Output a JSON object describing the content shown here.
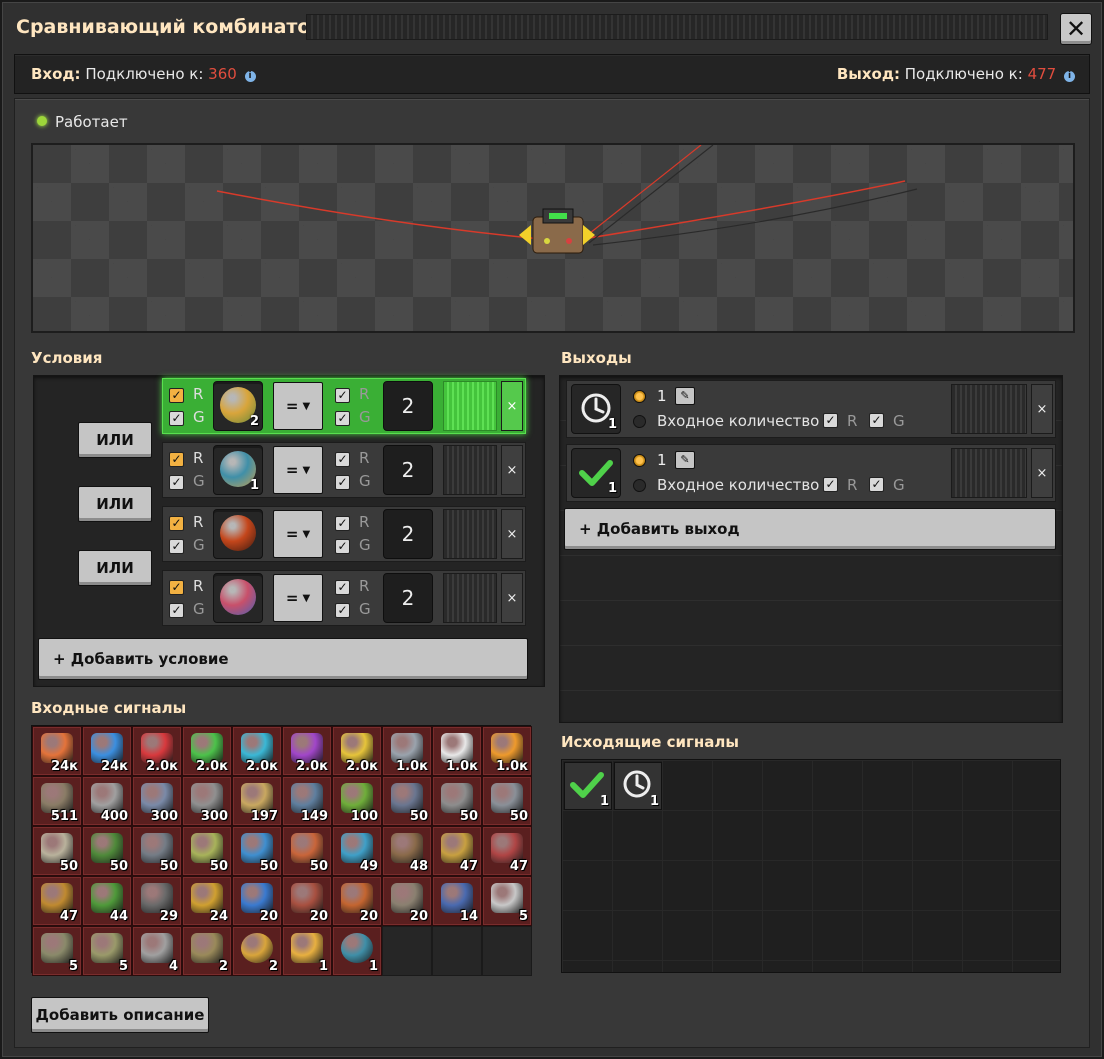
{
  "window": {
    "title": "Сравнивающий комбинатор",
    "close_label": "✕"
  },
  "connection": {
    "input_label": "Вход:",
    "input_text": "Подключено к:",
    "input_count": "360",
    "output_label": "Выход:",
    "output_text": "Подключено к:",
    "output_count": "477"
  },
  "status": {
    "text": "Работает"
  },
  "conditions": {
    "title": "Условия",
    "or_label": "ИЛИ",
    "add_label": "+ Добавить условие",
    "rows": [
      {
        "r": "R",
        "g": "G",
        "count": "2",
        "operator": "=",
        "r2": "R",
        "g2": "G",
        "value": "2",
        "remove": "×",
        "planet_color": "#d9a53b",
        "planet_color2": "#6b8a3a"
      },
      {
        "r": "R",
        "g": "G",
        "count": "1",
        "operator": "=",
        "r2": "R",
        "g2": "G",
        "value": "2",
        "remove": "×",
        "planet_color": "#3f8fa8",
        "planet_color2": "#c2a055"
      },
      {
        "r": "R",
        "g": "G",
        "count": "",
        "operator": "=",
        "r2": "R",
        "g2": "G",
        "value": "2",
        "remove": "×",
        "planet_color": "#c4461b",
        "planet_color2": "#3a1a10"
      },
      {
        "r": "R",
        "g": "G",
        "count": "",
        "operator": "=",
        "r2": "R",
        "g2": "G",
        "value": "2",
        "remove": "×",
        "planet_color": "#c8506a",
        "planet_color2": "#4c5fb4"
      }
    ]
  },
  "outputs": {
    "title": "Выходы",
    "add_label": "+ Добавить выход",
    "rows": [
      {
        "icon": "clock-icon",
        "slot_count": "1",
        "value": "1",
        "mode": "Входное количество",
        "r": "R",
        "g": "G",
        "remove": "×"
      },
      {
        "icon": "checkmark-icon",
        "slot_count": "1",
        "value": "1",
        "mode": "Входное количество",
        "r": "R",
        "g": "G",
        "remove": "×"
      }
    ]
  },
  "input_signals": {
    "title": "Входные сигналы",
    "items": [
      {
        "icon": "crude-oil-icon",
        "count": "24к",
        "color": "#e4733a"
      },
      {
        "icon": "water-icon",
        "count": "24к",
        "color": "#3b8fe0"
      },
      {
        "icon": "red-science-pack-icon",
        "count": "2.0к",
        "color": "#d8393d"
      },
      {
        "icon": "green-science-pack-icon",
        "count": "2.0к",
        "color": "#4cc24a"
      },
      {
        "icon": "blue-science-pack-icon",
        "count": "2.0к",
        "color": "#3ab8d6"
      },
      {
        "icon": "purple-science-pack-icon",
        "count": "2.0к",
        "color": "#a146c9"
      },
      {
        "icon": "yellow-science-pack-icon",
        "count": "2.0к",
        "color": "#e6c43a"
      },
      {
        "icon": "gray-science-pack-icon",
        "count": "1.0к",
        "color": "#9aa3ad"
      },
      {
        "icon": "white-science-pack-icon",
        "count": "1.0к",
        "color": "#e8e8e8"
      },
      {
        "icon": "orange-science-pack-icon",
        "count": "1.0к",
        "color": "#ee9a2c"
      },
      {
        "icon": "rail-icon",
        "count": "511",
        "color": "#8a7c66"
      },
      {
        "icon": "stone-brick-icon",
        "count": "400",
        "color": "#a0a0a0"
      },
      {
        "icon": "belt-icon",
        "count": "300",
        "color": "#7a8aa8"
      },
      {
        "icon": "concrete-icon",
        "count": "300",
        "color": "#909090"
      },
      {
        "icon": "repair-pack-icon",
        "count": "197",
        "color": "#c9a860"
      },
      {
        "icon": "cliff-explosives-icon",
        "count": "149",
        "color": "#5f7f9f"
      },
      {
        "icon": "inserter-icon",
        "count": "100",
        "color": "#6fae3a"
      },
      {
        "icon": "medium-pole-icon",
        "count": "50",
        "color": "#6a7690"
      },
      {
        "icon": "big-pole-icon",
        "count": "50",
        "color": "#8d8d8d"
      },
      {
        "icon": "substation-icon",
        "count": "50",
        "color": "#8a9098"
      },
      {
        "icon": "pump-icon",
        "count": "50",
        "color": "#b9b29c"
      },
      {
        "icon": "circuit-icon",
        "count": "50",
        "color": "#4f8a3a"
      },
      {
        "icon": "engine-icon",
        "count": "50",
        "color": "#747c86"
      },
      {
        "icon": "gear-assembler-icon",
        "count": "50",
        "color": "#a8b35a"
      },
      {
        "icon": "fluid-tank-icon",
        "count": "50",
        "color": "#3f8fd0"
      },
      {
        "icon": "chest-icon",
        "count": "50",
        "color": "#c9653a"
      },
      {
        "icon": "fast-inserter-icon",
        "count": "49",
        "color": "#3fa0c8"
      },
      {
        "icon": "loader-icon",
        "count": "48",
        "color": "#8a6a4a"
      },
      {
        "icon": "long-inserter-icon",
        "count": "47",
        "color": "#c8a040"
      },
      {
        "icon": "rocket-silo-icon",
        "count": "47",
        "color": "#b04545"
      },
      {
        "icon": "turret-icon",
        "count": "47",
        "color": "#c08a30"
      },
      {
        "icon": "processor-icon",
        "count": "44",
        "color": "#4f9a3a"
      },
      {
        "icon": "gravel-icon",
        "count": "29",
        "color": "#6a6a6a"
      },
      {
        "icon": "rocket-launcher-icon",
        "count": "24",
        "color": "#d0a030"
      },
      {
        "icon": "battery-pack-icon",
        "count": "20",
        "color": "#3a7ad0"
      },
      {
        "icon": "mech-suit-icon",
        "count": "20",
        "color": "#a85040"
      },
      {
        "icon": "biochamber-icon",
        "count": "20",
        "color": "#c46530"
      },
      {
        "icon": "radar-icon",
        "count": "20",
        "color": "#8a8070"
      },
      {
        "icon": "foundry-icon",
        "count": "14",
        "color": "#4a6ab0"
      },
      {
        "icon": "tile-icon",
        "count": "5",
        "color": "#c8c8c8"
      },
      {
        "icon": "crusher-icon",
        "count": "5",
        "color": "#8a8a6a"
      },
      {
        "icon": "landfill-icon",
        "count": "5",
        "color": "#9a9a6a"
      },
      {
        "icon": "agri-tower-icon",
        "count": "4",
        "color": "#a0a0a0"
      },
      {
        "icon": "recycler-icon",
        "count": "2",
        "color": "#9a8a5a"
      },
      {
        "icon": "planet-icon",
        "count": "2",
        "color": "#d9a53b"
      },
      {
        "icon": "rocket-icon",
        "count": "1",
        "color": "#e8b040"
      },
      {
        "icon": "planet-blue-icon",
        "count": "1",
        "color": "#3f8fa8"
      }
    ]
  },
  "output_signals": {
    "title": "Исходящие сигналы",
    "items": [
      {
        "icon": "checkmark-icon",
        "count": "1"
      },
      {
        "icon": "clock-icon",
        "count": "1"
      }
    ]
  },
  "description": {
    "add_label": "Добавить описание"
  }
}
